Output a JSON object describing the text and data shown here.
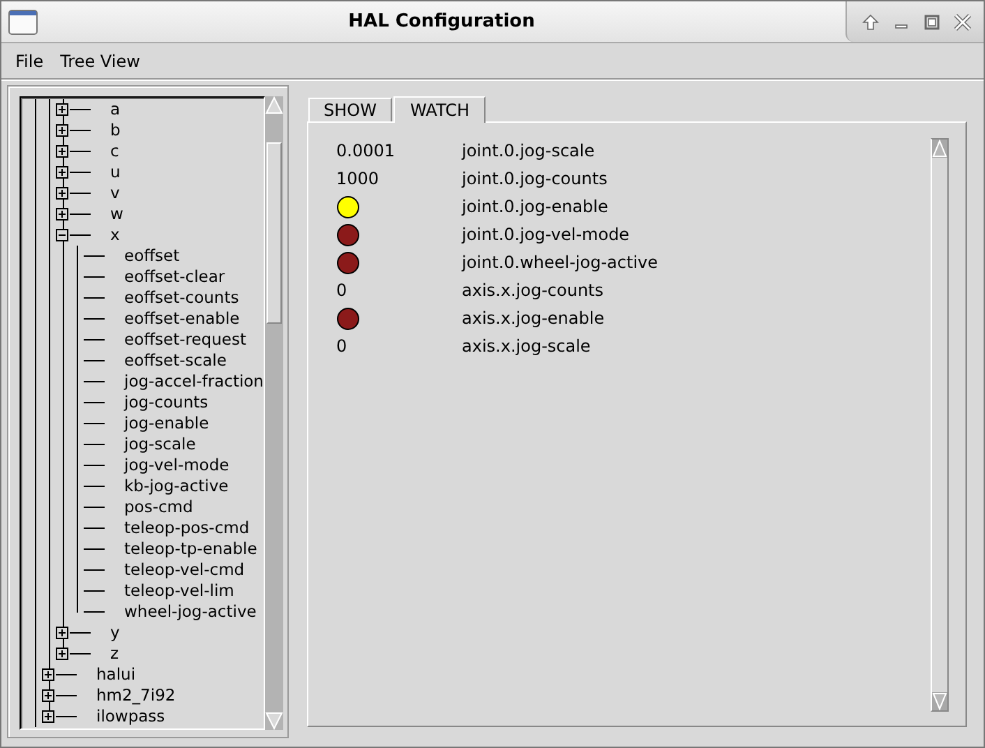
{
  "window": {
    "title": "HAL Configuration"
  },
  "menu": [
    {
      "label": "File"
    },
    {
      "label": "Tree View"
    }
  ],
  "tree": {
    "items": [
      {
        "children": [
          {
            "children": [
              {
                "label": "a",
                "expanded": false
              },
              {
                "label": "b",
                "expanded": false
              },
              {
                "label": "c",
                "expanded": false
              },
              {
                "label": "u",
                "expanded": false
              },
              {
                "label": "v",
                "expanded": false
              },
              {
                "label": "w",
                "expanded": false
              },
              {
                "label": "x",
                "expanded": true,
                "children": [
                  {
                    "label": "eoffset"
                  },
                  {
                    "label": "eoffset-clear"
                  },
                  {
                    "label": "eoffset-counts"
                  },
                  {
                    "label": "eoffset-enable"
                  },
                  {
                    "label": "eoffset-request"
                  },
                  {
                    "label": "eoffset-scale"
                  },
                  {
                    "label": "jog-accel-fraction"
                  },
                  {
                    "label": "jog-counts"
                  },
                  {
                    "label": "jog-enable"
                  },
                  {
                    "label": "jog-scale"
                  },
                  {
                    "label": "jog-vel-mode"
                  },
                  {
                    "label": "kb-jog-active"
                  },
                  {
                    "label": "pos-cmd"
                  },
                  {
                    "label": "teleop-pos-cmd"
                  },
                  {
                    "label": "teleop-tp-enable"
                  },
                  {
                    "label": "teleop-vel-cmd"
                  },
                  {
                    "label": "teleop-vel-lim"
                  },
                  {
                    "label": "wheel-jog-active"
                  }
                ]
              },
              {
                "label": "y",
                "expanded": false
              },
              {
                "label": "z",
                "expanded": false
              }
            ]
          },
          {
            "label": "halui",
            "expanded": false
          },
          {
            "label": "hm2_7i92",
            "expanded": false
          },
          {
            "label": "ilowpass",
            "expanded": false
          }
        ]
      }
    ]
  },
  "tabs": [
    {
      "label": "SHOW",
      "selected": false
    },
    {
      "label": "WATCH",
      "selected": true
    }
  ],
  "watch": [
    {
      "kind": "value",
      "value": "0.0001",
      "name": "joint.0.jog-scale"
    },
    {
      "kind": "value",
      "value": "1000",
      "name": "joint.0.jog-counts"
    },
    {
      "kind": "bit",
      "on": true,
      "name": "joint.0.jog-enable"
    },
    {
      "kind": "bit",
      "on": false,
      "name": "joint.0.jog-vel-mode"
    },
    {
      "kind": "bit",
      "on": false,
      "name": "joint.0.wheel-jog-active"
    },
    {
      "kind": "value",
      "value": "0",
      "name": "axis.x.jog-counts"
    },
    {
      "kind": "bit",
      "on": false,
      "name": "axis.x.jog-enable"
    },
    {
      "kind": "value",
      "value": "0",
      "name": "axis.x.jog-scale"
    }
  ]
}
